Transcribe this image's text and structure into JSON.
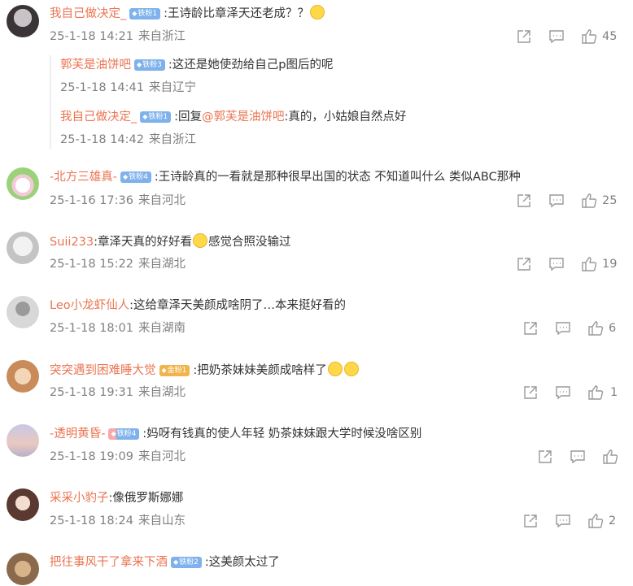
{
  "comments": [
    {
      "user": "我自己做决定_",
      "badge": "铁粉1",
      "badge_type": "blue",
      "sep": ":",
      "text": "王诗龄比章泽天还老成？？",
      "emoji": "smile",
      "date": "25-1-18 14:21",
      "location": "来自浙江",
      "likes": "45",
      "replies": [
        {
          "user": "郭芙是油饼吧",
          "badge": "铁粉3",
          "sep": ":",
          "text": "这还是她使劲给自己p图后的呢",
          "date": "25-1-18 14:41",
          "location": "来自辽宁"
        },
        {
          "user": "我自己做决定_",
          "badge": "铁粉1",
          "sep": ":",
          "reply_prefix": "回复",
          "mention": "@郭芙是油饼吧",
          "text": ":真的，小姑娘自然点好",
          "date": "25-1-18 14:42",
          "location": "来自浙江"
        }
      ]
    },
    {
      "user": "-北方三雄真-",
      "badge": "铁粉4",
      "badge_type": "blue",
      "sep": ":",
      "text": "王诗龄真的一看就是那种很早出国的状态 不知道叫什么 类似ABC那种",
      "date": "25-1-16 17:36",
      "location": "来自河北",
      "likes": "25"
    },
    {
      "user": "Suii233",
      "badge": "",
      "sep": ":",
      "text": "章泽天真的好好看",
      "emoji_after": "cry",
      "text2": "感觉合照没输过",
      "date": "25-1-18 15:22",
      "location": "来自湖北",
      "likes": "19"
    },
    {
      "user": "Leo小龙虾仙人",
      "badge": "",
      "sep": ":",
      "text": "这给章泽天美颜成啥阴了…本来挺好看的",
      "date": "25-1-18 18:01",
      "location": "来自湖南",
      "likes": "6"
    },
    {
      "user": "突突遇到困难睡大觉",
      "badge": "金粉1",
      "badge_type": "gold",
      "sep": ":",
      "text": "把奶茶妹妹美颜成啥样了",
      "emoji_end": "cry2",
      "date": "25-1-18 19:31",
      "location": "来自湖北",
      "likes": "1"
    },
    {
      "user": "-透明黄昏-",
      "badge": "铁粉4",
      "badge_type": "blue",
      "sep": ":",
      "text": "妈呀有钱真的使人年轻 奶茶妹妹跟大学时候没啥区别",
      "date": "25-1-18 19:09",
      "location": "来自河北",
      "likes": ""
    },
    {
      "user": "采采小豹子",
      "badge": "",
      "sep": ":",
      "text": "像俄罗斯娜娜",
      "date": "25-1-18 18:24",
      "location": "来自山东",
      "likes": "2"
    },
    {
      "user": "把往事风干了拿来下酒",
      "badge": "铁粉2",
      "badge_type": "blue",
      "sep": ":",
      "text": "这美颜太过了",
      "date": "",
      "location": "",
      "likes": ""
    }
  ],
  "icons": {
    "share": "share-icon",
    "reply": "comment-icon",
    "like": "thumbs-up-icon"
  },
  "colors": {
    "username": "#eb7350",
    "meta": "#808080",
    "badge_blue": "#7fb2ec",
    "badge_gold": "#f1b44c"
  }
}
